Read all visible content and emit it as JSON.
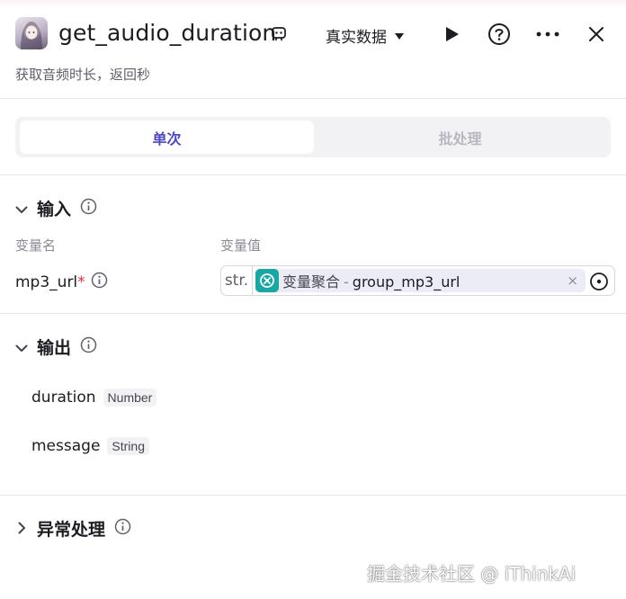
{
  "header": {
    "title": "get_audio_duration",
    "mode_label": "真实数据",
    "subtitle": "获取音频时长，返回秒"
  },
  "tabs": [
    {
      "label": "单次",
      "active": true
    },
    {
      "label": "批处理",
      "active": false
    }
  ],
  "input": {
    "section_title": "输入",
    "col_name": "变量名",
    "col_value": "变量值",
    "param": {
      "name": "mp3_url",
      "required_mark": "*",
      "type_tag": "str.",
      "ref_node": "变量聚合",
      "ref_separator": "-",
      "ref_var": "group_mp3_url",
      "clear_symbol": "×"
    }
  },
  "output": {
    "section_title": "输出",
    "fields": [
      {
        "name": "duration",
        "type": "Number"
      },
      {
        "name": "message",
        "type": "String"
      }
    ]
  },
  "exception": {
    "section_title": "异常处理"
  },
  "watermark": "掘金技术社区 @ iThinkAi",
  "colors": {
    "accent": "#4b47c6",
    "chip_icon_bg": "#18a7a4",
    "required": "#e0323a"
  }
}
